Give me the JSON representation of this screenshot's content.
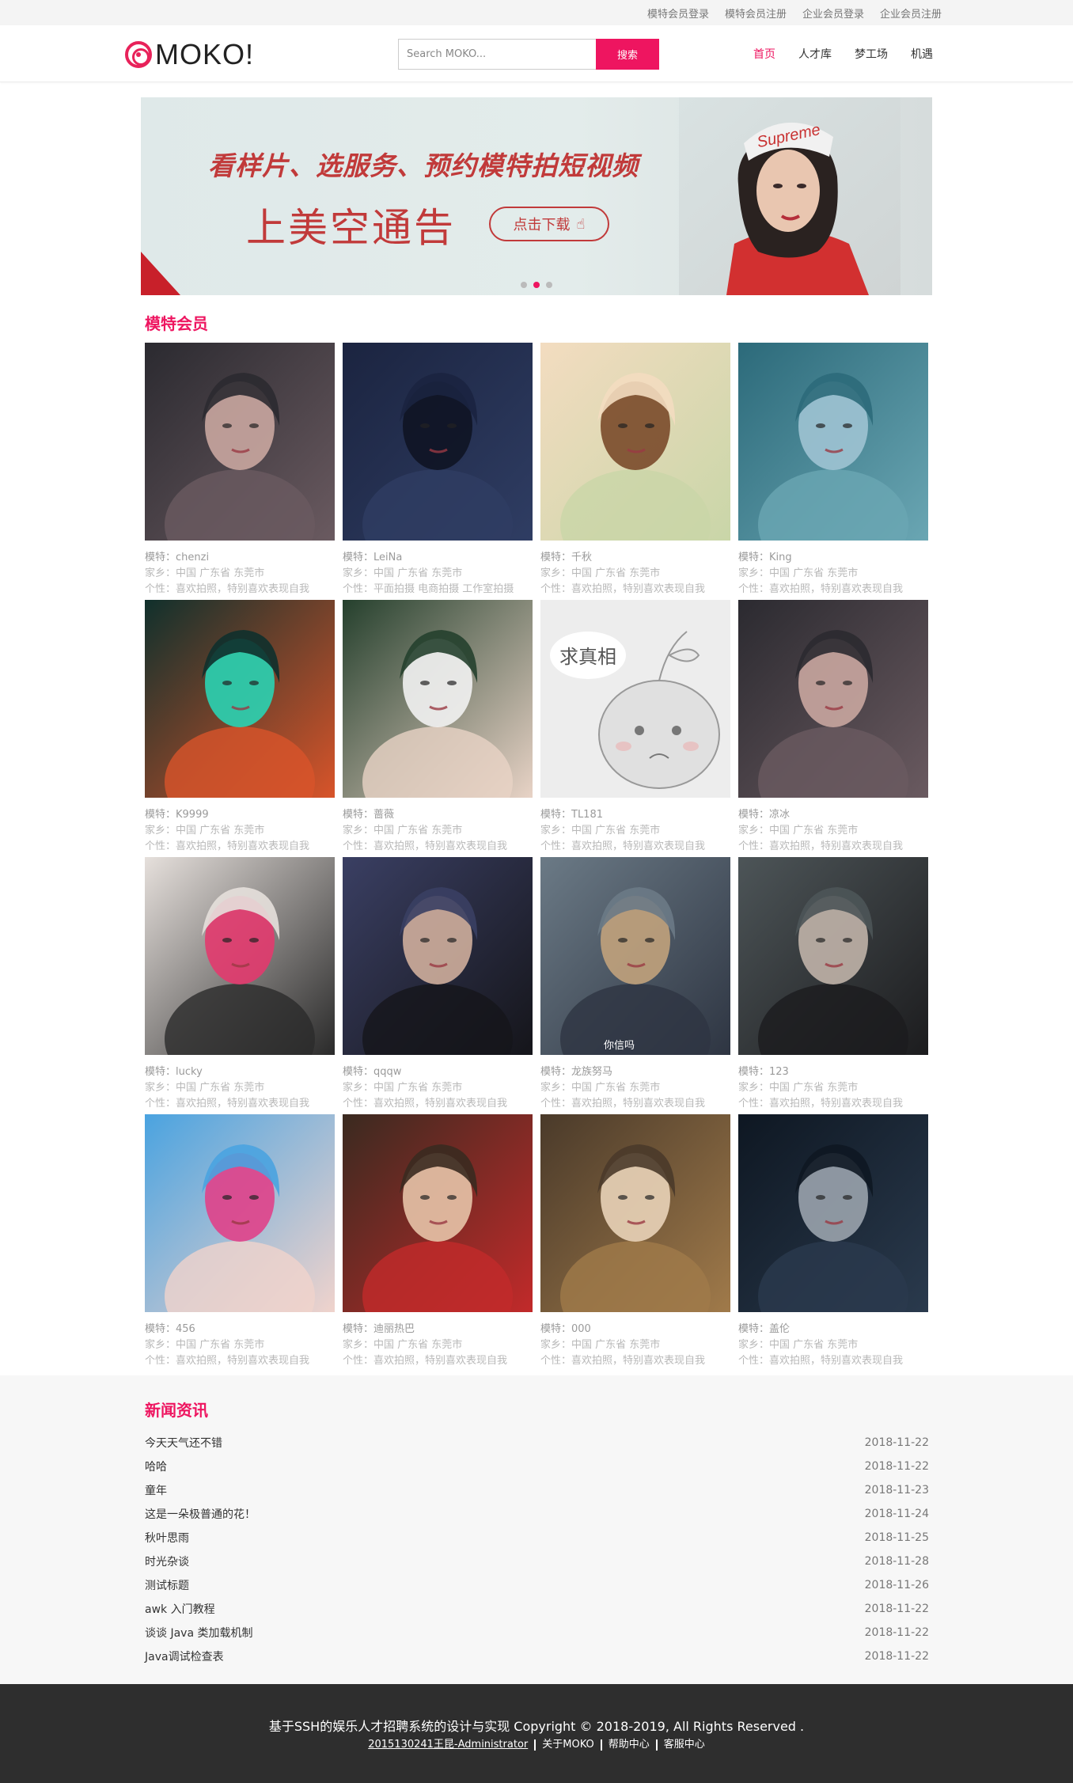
{
  "topbar": {
    "links": [
      "模特会员登录",
      "模特会员注册",
      "企业会员登录",
      "企业会员注册"
    ]
  },
  "header": {
    "logo_text": "MOKO!",
    "search_placeholder": "Search MOKO...",
    "search_button": "搜索",
    "nav": [
      "首页",
      "人才库",
      "梦工场",
      "机遇"
    ]
  },
  "banner": {
    "headline": "看样片、选服务、预约模特拍短视频",
    "subline": "上美空通告",
    "download_label": "点击下载",
    "cap_text": "Supreme",
    "dots": 3,
    "active_dot": 1
  },
  "models": {
    "title": "模特会员",
    "label_model": "模特：",
    "label_home": "家乡：",
    "label_personality": "个性：",
    "items": [
      {
        "name": "chenzi",
        "home": "中国 广东省 东莞市",
        "personality": "喜欢拍照，特别喜欢表现自我",
        "palette": [
          "#2b2a30",
          "#6a5a60",
          "#c9a6a0"
        ]
      },
      {
        "name": "LeiNa",
        "home": "中国 广东省 东莞市",
        "personality": "平面拍摄 电商拍摄 工作室拍摄",
        "palette": [
          "#1b2440",
          "#2f3d63",
          "#101424"
        ]
      },
      {
        "name": "千秋",
        "home": "中国 广东省 东莞市",
        "personality": "喜欢拍照，特别喜欢表现自我",
        "palette": [
          "#f3dcc0",
          "#c9d6a8",
          "#7a4a2a"
        ]
      },
      {
        "name": "King",
        "home": "中国 广东省 东莞市",
        "personality": "喜欢拍照，特别喜欢表现自我",
        "palette": [
          "#2c6a7a",
          "#6aa6b3",
          "#9ec3d3"
        ]
      },
      {
        "name": "K9999",
        "home": "中国 广东省 东莞市",
        "personality": "喜欢拍照，特别喜欢表现自我",
        "palette": [
          "#10302c",
          "#d8542a",
          "#2ad3b3"
        ]
      },
      {
        "name": "蔷薇",
        "home": "中国 广东省 东莞市",
        "personality": "喜欢拍照，特别喜欢表现自我",
        "palette": [
          "#25402d",
          "#e8d3c6",
          "#f2f2f2"
        ]
      },
      {
        "name": "TL181",
        "home": "中国 广东省 东莞市",
        "personality": "喜欢拍照，特别喜欢表现自我",
        "palette": [
          "#ededed",
          "#cfcfcf",
          "#999999"
        ],
        "placeholder_text": "求真相"
      },
      {
        "name": "凉冰",
        "home": "中国 广东省 东莞市",
        "personality": "喜欢拍照，特别喜欢表现自我",
        "palette": [
          "#2b2a30",
          "#6a5a60",
          "#c9a6a0"
        ]
      },
      {
        "name": "lucky",
        "home": "中国 广东省 东莞市",
        "personality": "喜欢拍照，特别喜欢表现自我",
        "palette": [
          "#e6e0dc",
          "#2a2a2a",
          "#e23a6e"
        ]
      },
      {
        "name": "qqqw",
        "home": "中国 广东省 东莞市",
        "personality": "喜欢拍照，特别喜欢表现自我",
        "palette": [
          "#3a3f63",
          "#15151a",
          "#cfae9c"
        ]
      },
      {
        "name": "龙族努马",
        "home": "中国 广东省 东莞市",
        "personality": "喜欢拍照，特别喜欢表现自我",
        "palette": [
          "#6b7a86",
          "#2e3542",
          "#c1a27c"
        ],
        "caption": "你信吗"
      },
      {
        "name": "123",
        "home": "中国 广东省 东莞市",
        "personality": "喜欢拍照，特别喜欢表现自我",
        "palette": [
          "#4d5558",
          "#1c1c1e",
          "#c0b3a8"
        ]
      },
      {
        "name": "456",
        "home": "中国 广东省 东莞市",
        "personality": "喜欢拍照，特别喜欢表现自我",
        "palette": [
          "#4aa3e0",
          "#f0d3cc",
          "#e0418a"
        ]
      },
      {
        "name": "迪丽热巴",
        "home": "中国 广东省 东莞市",
        "personality": "喜欢拍照，特别喜欢表现自我",
        "palette": [
          "#3a2a20",
          "#c22a2a",
          "#e7c3a8"
        ]
      },
      {
        "name": "000",
        "home": "中国 广东省 东莞市",
        "personality": "喜欢拍照，特别喜欢表现自我",
        "palette": [
          "#4a3a2a",
          "#a07a4a",
          "#e9d3b8"
        ]
      },
      {
        "name": "盖伦",
        "home": "中国 广东省 东莞市",
        "personality": "喜欢拍照，特别喜欢表现自我",
        "palette": [
          "#0e1722",
          "#2a3a4d",
          "#9aa3ad"
        ]
      }
    ]
  },
  "news": {
    "title": "新闻资讯",
    "items": [
      {
        "title": "今天天气还不错",
        "date": "2018-11-22"
      },
      {
        "title": "哈哈",
        "date": "2018-11-22"
      },
      {
        "title": "童年",
        "date": "2018-11-23"
      },
      {
        "title": "这是一朵极普通的花！",
        "date": "2018-11-24"
      },
      {
        "title": "秋叶思雨",
        "date": "2018-11-25"
      },
      {
        "title": "时光杂谈",
        "date": "2018-11-28"
      },
      {
        "title": "测试标题",
        "date": "2018-11-26"
      },
      {
        "title": "awk 入门教程",
        "date": "2018-11-22"
      },
      {
        "title": "谈谈 Java 类加载机制",
        "date": "2018-11-22"
      },
      {
        "title": "Java调试检查表",
        "date": "2018-11-22"
      }
    ]
  },
  "footer": {
    "copyright": "基于SSH的娱乐人才招聘系统的设计与实现 Copyright © 2018-2019, All Rights Reserved .",
    "links": [
      "2015130241王昆-Administrator",
      "关于MOKO",
      "帮助中心",
      "客服中心"
    ]
  },
  "colors": {
    "accent": "#ee1560",
    "footer_bg": "#2e2e2e",
    "news_bg": "#f7f7f7"
  }
}
